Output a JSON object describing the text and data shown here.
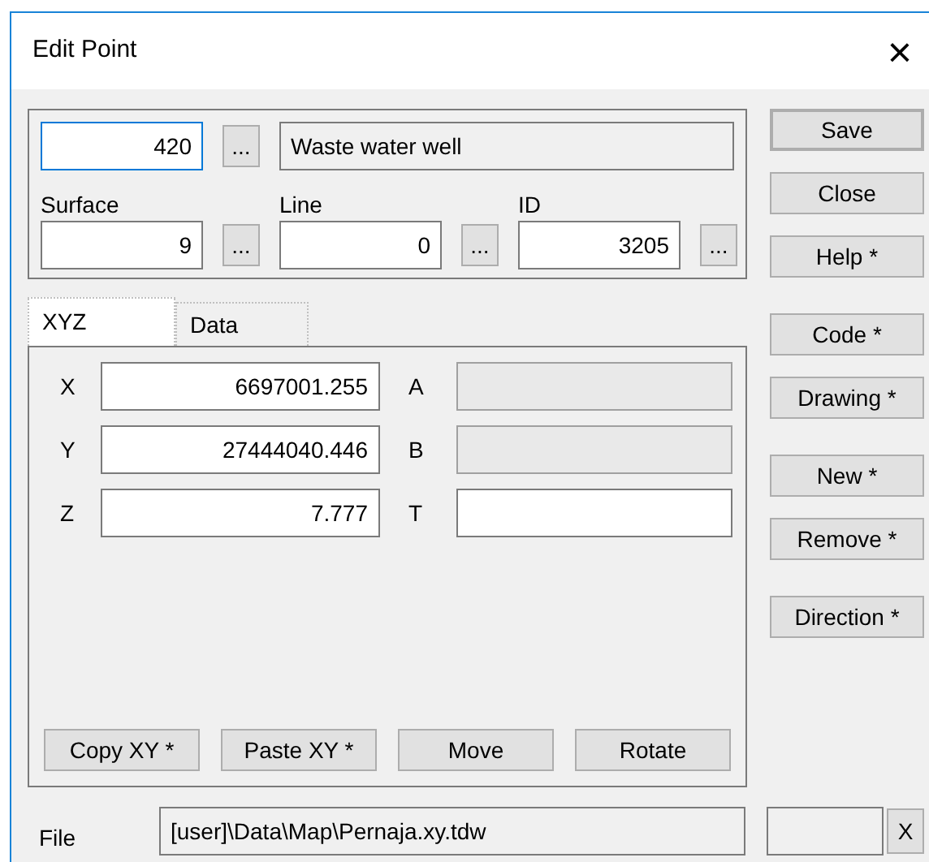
{
  "window": {
    "title": "Edit Point",
    "close": "×"
  },
  "header": {
    "code": {
      "value": "420",
      "focused": true
    },
    "browse": "...",
    "description": {
      "value": "Waste water well",
      "readonly": true
    },
    "fields": [
      {
        "label": "Surface",
        "value": "9",
        "browse": "..."
      },
      {
        "label": "Line",
        "value": "0",
        "browse": "..."
      },
      {
        "label": "ID",
        "value": "3205",
        "browse": "..."
      }
    ]
  },
  "side_button_groups": [
    [
      {
        "label": "Save",
        "default": true
      },
      {
        "label": "Close",
        "default": false
      },
      {
        "label": "Help *",
        "default": false
      }
    ],
    [
      {
        "label": "Code *",
        "default": false
      },
      {
        "label": "Drawing *",
        "default": false
      }
    ],
    [
      {
        "label": "New *",
        "default": false
      },
      {
        "label": "Remove *",
        "default": false
      }
    ],
    [
      {
        "label": "Direction *",
        "default": false
      }
    ]
  ],
  "tabs": [
    {
      "label": "XYZ",
      "selected": true
    },
    {
      "label": "Data",
      "selected": false
    }
  ],
  "coordinates": [
    {
      "label": "X",
      "value": "6697001.255",
      "extra_label": "A",
      "extra_readonly": true
    },
    {
      "label": "Y",
      "value": "27444040.446",
      "extra_label": "B",
      "extra_readonly": true
    },
    {
      "label": "Z",
      "value": "7.777",
      "extra_label": "T",
      "extra_readonly": false
    }
  ],
  "panel_buttons": [
    "Copy XY *",
    "Paste XY *",
    "Move",
    "Rotate"
  ],
  "file": {
    "label": "File",
    "value": "[user]\\Data\\Map\\Pernaja.xy.tdw",
    "clear": "X"
  }
}
